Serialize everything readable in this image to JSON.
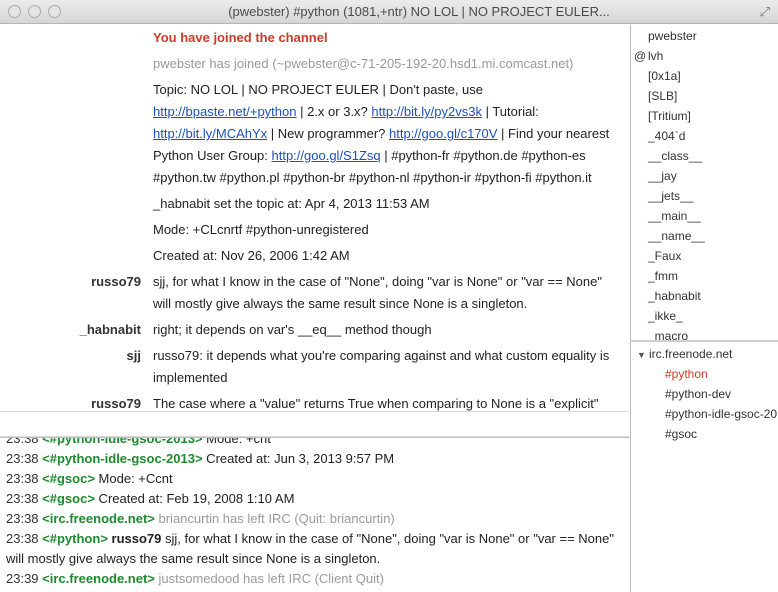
{
  "window": {
    "title": "(pwebster) #python (1081,+ntr) NO LOL | NO PROJECT EULER..."
  },
  "chat": {
    "joined": "You have joined the channel",
    "join_notice": "pwebster has joined (~pwebster@c-71-205-192-20.hsd1.mi.comcast.net)",
    "topic": {
      "p1": "Topic: NO LOL | NO PROJECT EULER | Don't paste, use ",
      "link1": "http://bpaste.net/+python",
      "p2": " | 2.x or 3.x? ",
      "link2": "http://bit.ly/py2vs3k",
      "p3": " | Tutorial: ",
      "link3": "http://bit.ly/MCAhYx",
      "p4": " | New programmer? ",
      "link4": "http://goo.gl/c170V",
      "p5": " | Find your nearest Python User Group: ",
      "link5": "http://goo.gl/S1Zsq",
      "p6": " | #python-fr #python.de #python-es #python.tw #python.pl #python-br #python-nl #python-ir #python-fi #python.it"
    },
    "topic_set": "_habnabit set the topic at: Apr 4, 2013 11:53 AM",
    "mode": "Mode: +CLcnrtf #python-unregistered",
    "created": "Created at: Nov 26, 2006 1:42 AM",
    "messages": [
      {
        "nick": "russo79",
        "text": "sjj, for what I know in the case of \"None\", doing \"var is None\" or \"var == None\" will mostly give always the same result since None is a singleton."
      },
      {
        "nick": "_habnabit",
        "text": "right; it depends on var's __eq__ method though"
      },
      {
        "nick": "sjj",
        "text": "russo79: it depends what you're comparing against and what custom equality is implemented"
      },
      {
        "nick": "russo79",
        "text": "The case where a \"value\" returns True when comparing to None is a \"explicit\" case whar custom equality has been implemented"
      }
    ]
  },
  "input": {
    "value": "",
    "placeholder": ""
  },
  "log": [
    {
      "time": "23:38",
      "chan": "<#python-idle-gsoc-2013>",
      "text": " Mode: +cnt"
    },
    {
      "time": "23:38",
      "chan": "<#python-idle-gsoc-2013>",
      "text": " Created at: Jun 3, 2013 9:57 PM"
    },
    {
      "time": "23:38",
      "chan": "<#gsoc>",
      "text": " Mode: +Ccnt"
    },
    {
      "time": "23:38",
      "chan": "<#gsoc>",
      "text": " Created at: Feb 19, 2008 1:10 AM"
    },
    {
      "time": "23:38",
      "chan": "<irc.freenode.net>",
      "text": " briancurtin has left IRC (Quit: briancurtin)"
    },
    {
      "time": "23:38",
      "chan": "<#python>",
      "nick": " russo79",
      "text": "   sjj, for what I know in the case of \"None\", doing \"var is None\" or \"var == None\" will mostly give always the same result since None is a singleton."
    },
    {
      "time": "23:39",
      "chan": "<irc.freenode.net>",
      "text": " justsomedood has left IRC (Client Quit)"
    }
  ],
  "users": [
    {
      "mode": "",
      "name": "pwebster"
    },
    {
      "mode": "@",
      "name": "lvh"
    },
    {
      "mode": "",
      "name": "[0x1a]"
    },
    {
      "mode": "",
      "name": "[SLB]"
    },
    {
      "mode": "",
      "name": "[Tritium]"
    },
    {
      "mode": "",
      "name": "_404`d"
    },
    {
      "mode": "",
      "name": "__class__"
    },
    {
      "mode": "",
      "name": "__jay"
    },
    {
      "mode": "",
      "name": "__jets__"
    },
    {
      "mode": "",
      "name": "__main__"
    },
    {
      "mode": "",
      "name": "__name__"
    },
    {
      "mode": "",
      "name": "_Faux"
    },
    {
      "mode": "",
      "name": "_fmm"
    },
    {
      "mode": "",
      "name": "_habnabit"
    },
    {
      "mode": "",
      "name": "_ikke_"
    },
    {
      "mode": "",
      "name": "_macro"
    }
  ],
  "tree": {
    "server": "irc.freenode.net",
    "channels": [
      {
        "name": "#python",
        "active": true
      },
      {
        "name": "#python-dev",
        "active": false
      },
      {
        "name": "#python-idle-gsoc-20",
        "active": false
      },
      {
        "name": "#gsoc",
        "active": false
      }
    ]
  },
  "colors": {
    "joined_red": "#d03a2a",
    "channel_green": "#1e8a2e",
    "link_blue": "#1b4fc2"
  }
}
